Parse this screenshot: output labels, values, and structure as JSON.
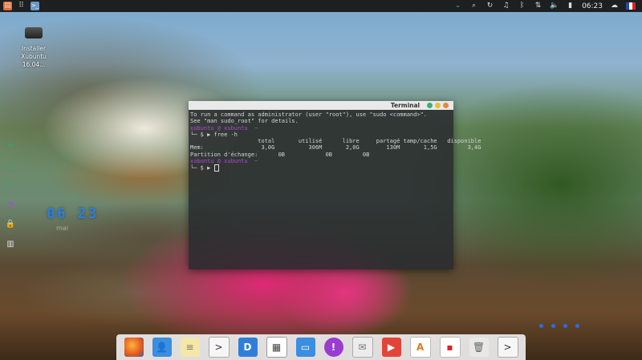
{
  "topbar": {
    "left_icons": [
      "app-launcher-icon",
      "grid-icon",
      "terminal-icon"
    ],
    "right_icons": [
      "chevron-down-icon",
      "search-icon",
      "refresh-icon",
      "headphones-icon",
      "bluetooth-icon",
      "network-icon",
      "volume-icon",
      "battery-icon"
    ],
    "time": "06:23",
    "colors": {
      "bg": "#1d1f21",
      "accent_green": "#3cc07a"
    }
  },
  "desktop_icon": {
    "label_line1": "Installer",
    "label_line2": "Xubuntu 16.04..."
  },
  "side_icons": [
    "airplane-icon",
    "chat-icon",
    "back-arrow-icon",
    "mask-icon",
    "lock-icon",
    "bar-chart-icon"
  ],
  "clock_widget": {
    "time": "06 23",
    "date": "mai"
  },
  "terminal": {
    "title": "Terminal",
    "lines": [
      "To run a command as administrator (user \"root\"), use \"sudo <command>\".",
      "See \"man sudo_root\" for details.",
      "",
      "xubuntu @ xubuntu  ~",
      "└─ $ ▶ free -h",
      "                    total       utilisé      libre     partagé tamp/cache   disponible",
      "Mem:                 3,0G          306M       2,0G        130M       1,5G         3,4G",
      "Partition d'échange:      0B            0B         0B",
      "xubuntu @ xubuntu  ~",
      "└─ $ ▶ "
    ]
  },
  "dock": {
    "items": [
      "firefox-icon",
      "contacts-icon",
      "notes-icon",
      "terminal-icon",
      "dictionary-icon",
      "tiles-icon",
      "window-icon",
      "chat-icon",
      "mail-icon",
      "video-icon",
      "software-icon",
      "screenshot-icon",
      "trash-icon",
      "terminal-icon"
    ]
  }
}
